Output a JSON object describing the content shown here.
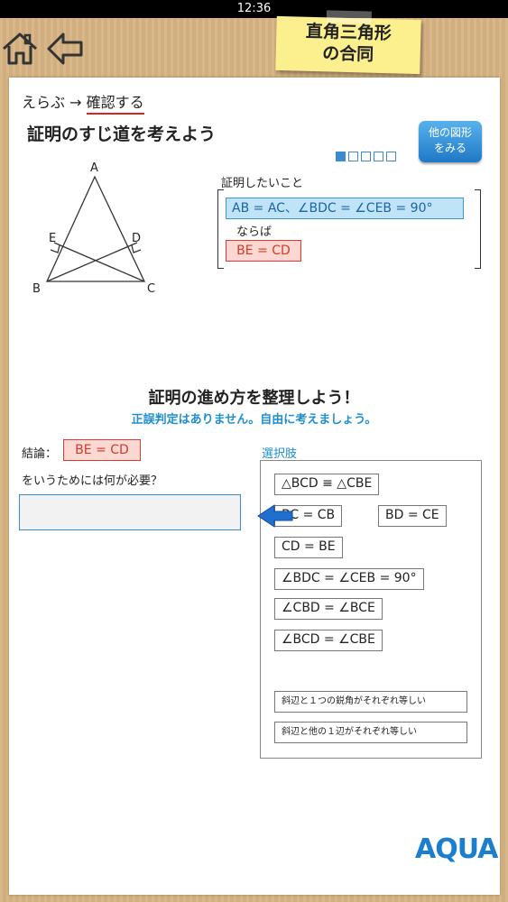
{
  "status_bar": {
    "time": "12:36"
  },
  "header": {
    "title_line1": "直角三角形",
    "title_line2": "の合同"
  },
  "breadcrumb": {
    "step1": "えらぶ",
    "arrow": "→",
    "step2": "確認する"
  },
  "problem": {
    "heading": "証明のすじ道を考えよう",
    "other_button_line1": "他の図形",
    "other_button_line2": "をみる",
    "progress": {
      "total": 5,
      "current": 1
    },
    "figure_labels": {
      "A": "A",
      "B": "B",
      "C": "C",
      "D": "D",
      "E": "E"
    },
    "prove_label": "証明したいこと",
    "given": "AB = AC、∠BDC = ∠CEB = 90°",
    "naraba": "ならば",
    "target": "BE = CD"
  },
  "organize": {
    "title": "証明の進め方を整理しよう！",
    "note": "正誤判定はありません。自由に考えましょう。",
    "conclusion_label": "結論：",
    "conclusion_value": "BE = CD",
    "need_text": "をいうためには何が必要？"
  },
  "choices": {
    "label": "選択肢",
    "items": [
      "△BCD ≡ △CBE",
      "BC = CB",
      "BD = CE",
      "CD = BE",
      "∠BDC = ∠CEB = 90°",
      "∠CBD = ∠BCE",
      "∠BCD = ∠CBE",
      "斜辺と１つの鋭角がそれぞれ等しい",
      "斜辺と他の１辺がそれぞれ等しい"
    ]
  },
  "logo": "AQUA",
  "colors": {
    "accent_blue": "#3c8ad0",
    "target_red": "#e03a2f",
    "given_blue": "#bfe4f8",
    "sticky_yellow": "#fcef8e"
  },
  "icons": {
    "home": "home-icon",
    "back": "back-arrow-icon",
    "drag_arrow": "arrow-left-icon"
  }
}
